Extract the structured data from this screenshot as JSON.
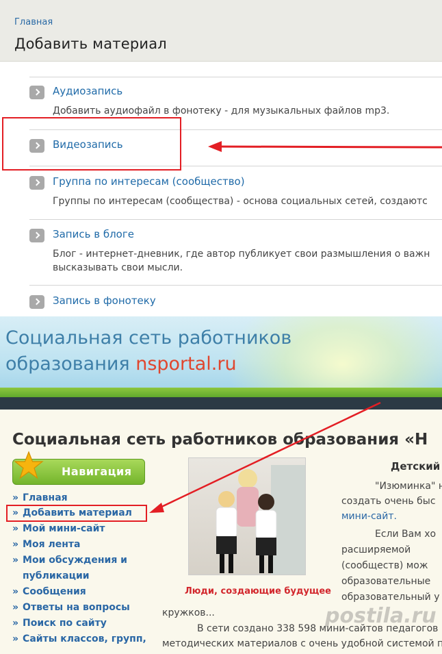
{
  "top": {
    "breadcrumb": "Главная",
    "title": "Добавить материал",
    "items": [
      {
        "label": "Аудиозапись",
        "desc": [
          "Добавить аудиофайл в фонотеку - для музыкальных файлов mp3."
        ]
      },
      {
        "label": "Видеозапись",
        "desc": []
      },
      {
        "label": "Группа по интересам (сообщество)",
        "desc": [
          "Группы по интересам (сообщества) - основа социальных сетей, создаютс"
        ]
      },
      {
        "label": "Запись в блоге",
        "desc": [
          "Блог - интернет-дневник, где автор публикует свои размышления о важн",
          "высказывать свои мысли."
        ]
      },
      {
        "label": "Запись в фонотеку",
        "desc": []
      }
    ],
    "highlight_color": "#e31e24",
    "link_color": "#1f6aa8"
  },
  "bottom": {
    "banner_line1": "Социальная сеть работников",
    "banner_line2_prefix": "образования ",
    "banner_domain": "nsportal.ru",
    "site_title": "Социальная сеть работников образования «Н",
    "nav": {
      "title": "Навигация",
      "bullet": "»",
      "items": [
        "Главная",
        "Добавить материал",
        "Мой мини-сайт",
        "Моя лента",
        "Мои обсуждения и",
        "публикации",
        "Сообщения",
        "Ответы на вопросы",
        "Поиск по сайту",
        "Сайты классов, групп,"
      ]
    },
    "photo_caption": "Люди, создающие будущее",
    "article": {
      "heading": "Детский",
      "lines": [
        "\"Изюминка\"  н",
        "создать  очень  быс",
        "мини-сайт.",
        "Если  Вам  хо",
        "расширяемой",
        "(сообществ)       мож",
        "образовательные",
        "образовательный    у",
        "кружков...",
        "В  сети  создано  338 598  мини-сайтов педагогов",
        "методических материалов с очень удобной системой по"
      ]
    },
    "watermark": "postila.ru"
  }
}
